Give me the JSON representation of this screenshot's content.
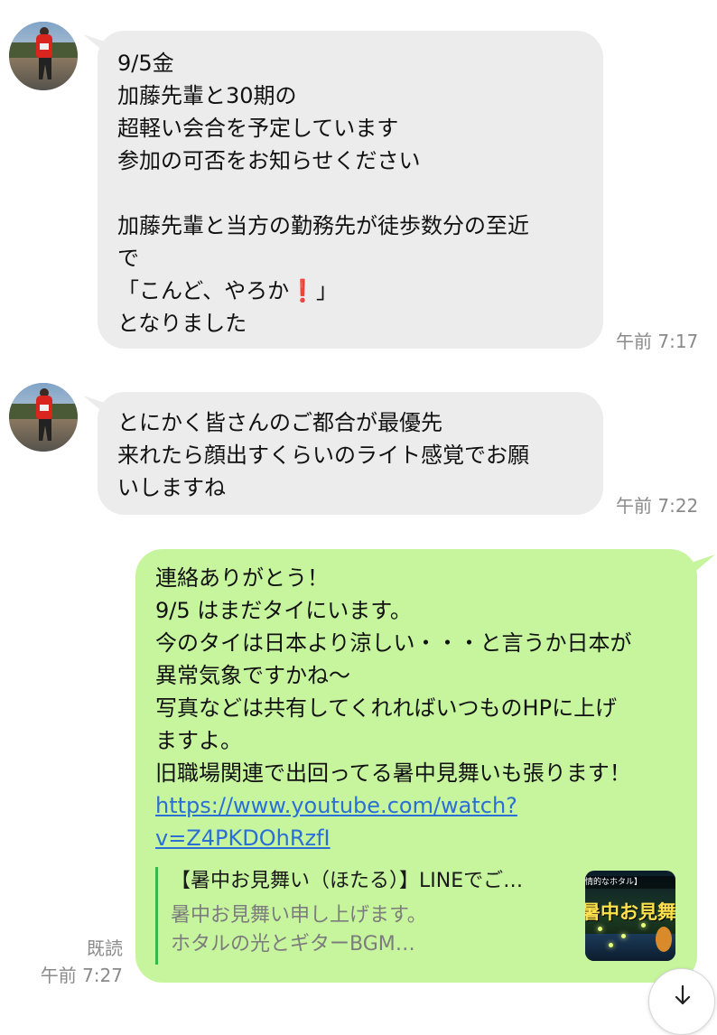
{
  "messages": [
    {
      "lines": [
        "9/5金",
        "加藤先輩と30期の",
        "超軽い会合を予定しています",
        "参加の可否をお知らせください",
        "",
        "加藤先輩と当方の勤務先が徒歩数分の至近",
        "で"
      ],
      "exclaim_line": {
        "before": "「こんど、やろか",
        "mark": "❗",
        "after": "」"
      },
      "last_line": "となりました",
      "time": "午前 7:17"
    },
    {
      "lines": [
        "とにかく皆さんのご都合が最優先",
        "来れたら顔出すくらいのライト感覚でお願",
        "いしますね"
      ],
      "time": "午前 7:22"
    },
    {
      "lines": [
        "連絡ありがとう！",
        "9/5 はまだタイにいます。",
        "今のタイは日本より涼しい・・・と言うか日本が",
        "異常気象ですかね〜",
        "写真などは共有してくれればいつものHPに上げ",
        "ますよ。",
        "旧職場関連で出回ってる暑中見舞いも張ります！"
      ],
      "link_lines": [
        "https://www.youtube.com/watch?",
        "v=Z4PKDOhRzfI"
      ],
      "preview": {
        "title": "【暑中お見舞い（ほたる）】LINEでご…",
        "desc_lines": [
          "暑中お見舞い申し上げます。",
          "ホタルの光とギターBGM…"
        ],
        "thumb_bar": "情的なホタル】",
        "thumb_title": "暑中お見舞い"
      },
      "read": "既読",
      "time": "午前 7:27"
    }
  ],
  "icons": {
    "avatar": "runner-photo",
    "scroll": "arrow-down-icon"
  }
}
